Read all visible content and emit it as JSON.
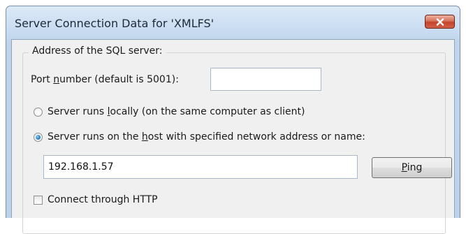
{
  "window": {
    "title": "Server Connection Data for 'XMLFS'",
    "close_glyph": "✕"
  },
  "group": {
    "label": "Address of the SQL server:"
  },
  "port": {
    "label_before": "Port ",
    "label_mnemonic": "n",
    "label_after": "umber (default is 5001):",
    "value": ""
  },
  "radio_local": {
    "label_before": "Server runs ",
    "label_mnemonic": "l",
    "label_after": "ocally (on the same computer as client)",
    "checked": false
  },
  "radio_host": {
    "label_before": "Server runs on the ",
    "label_mnemonic": "h",
    "label_after": "ost with specified network address or name:",
    "checked": true
  },
  "host": {
    "value": "192.168.1.57"
  },
  "ping_button": {
    "label_mnemonic": "P",
    "label_after": "ing"
  },
  "http_checkbox": {
    "label": "Connect through HTTP",
    "checked": false
  },
  "colors": {
    "titlebar": "#c9dcf1",
    "close_button": "#c4432a",
    "radio_selected": "#1f6fb8"
  }
}
